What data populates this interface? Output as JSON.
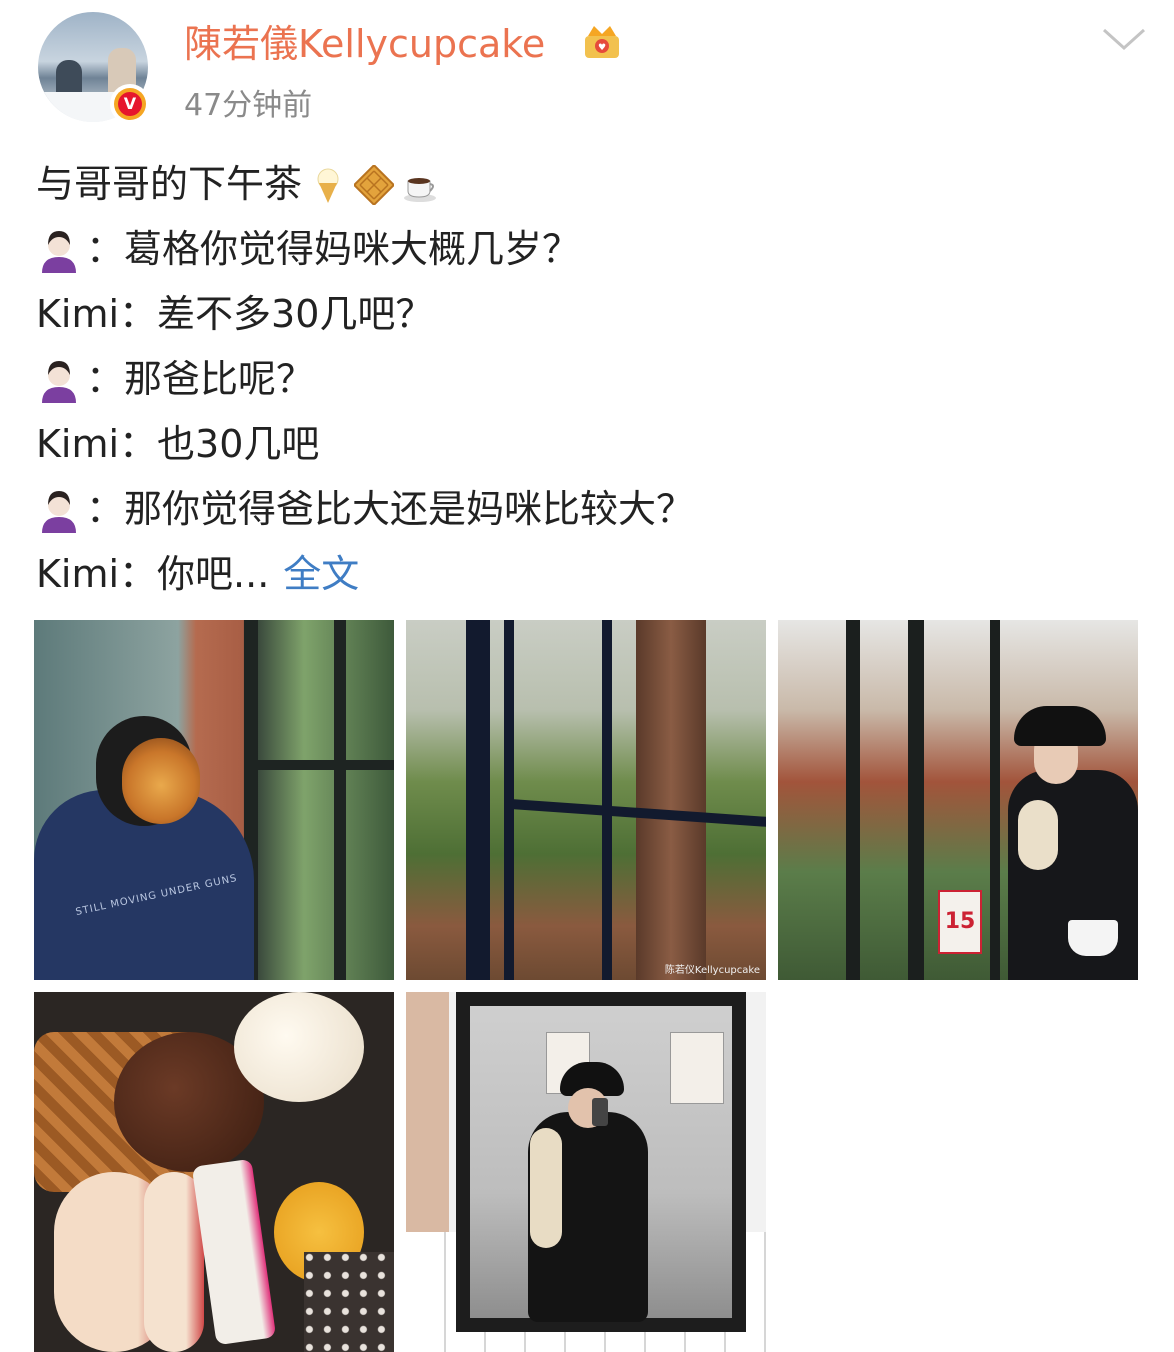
{
  "post": {
    "username": "陳若儀Kellycupcake",
    "time": "47分钟前",
    "verified_badge": "V",
    "lines": [
      {
        "prefix_type": "none",
        "text": "与哥哥的下午茶",
        "emojis": [
          "ice-cream-icon",
          "waffle-icon",
          "coffee-icon"
        ]
      },
      {
        "prefix_type": "girl-emoji",
        "text": "：葛格你觉得妈咪大概几岁？"
      },
      {
        "prefix_type": "text",
        "text": "Kimi：差不多30几吧？"
      },
      {
        "prefix_type": "girl-emoji",
        "text": "：那爸比呢？"
      },
      {
        "prefix_type": "text",
        "text": "Kimi：也30几吧"
      },
      {
        "prefix_type": "girl-emoji",
        "text": "：那你觉得爸比大还是妈咪比较大？"
      },
      {
        "prefix_type": "text",
        "text": "Kimi：你吧..."
      }
    ],
    "more_link": "全文"
  },
  "images": {
    "tile2_watermark": "陈若仪Kellycupcake",
    "tile1_print": "STILL MOVING UNDER GUNS",
    "tile3_sign_number": "15"
  },
  "colors": {
    "username": "#eb7350",
    "link": "#3f7dc4",
    "time": "#8a8a8a",
    "text": "#222222"
  }
}
